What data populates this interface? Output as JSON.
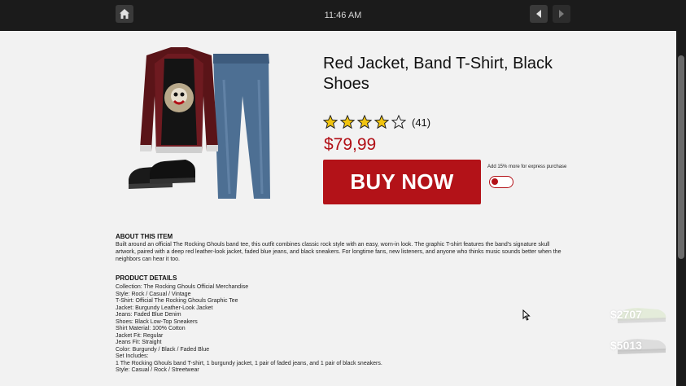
{
  "system_bar": {
    "time": "11:46 AM",
    "icons": [
      "home-icon",
      "back-arrow-icon",
      "forward-arrow-icon"
    ]
  },
  "product": {
    "title": "Red Jacket, Band T-Shirt, Black Shoes",
    "rating": 4,
    "rating_max": 5,
    "rating_count": "(41)",
    "price": "$79,99",
    "buy_label": "BUY NOW",
    "express_label": "Add 15% more for express purchase",
    "express_enabled": false,
    "accent_color": "#b31218"
  },
  "about": {
    "heading": "ABOUT THIS ITEM",
    "text": "Built around an official The Rocking Ghouls band tee, this outfit combines classic rock style with an easy, worn-in look. The graphic T-shirt features the band's signature skull artwork, paired with a deep red leather-look jacket, faded blue jeans, and black sneakers. For longtime fans, new listeners, and anyone who thinks music sounds better when the neighbors can hear it too."
  },
  "details": {
    "heading": "PRODUCT DETAILS",
    "items": [
      "Collection: The Rocking Ghouls Official Merchandise",
      "Style: Rock / Casual / Vintage",
      "T-Shirt: Official The Rocking Ghouls Graphic Tee",
      "Jacket: Burgundy Leather-Look Jacket",
      "Jeans: Faded Blue Denim",
      "Shoes: Black Low-Top Sneakers",
      "Shirt Material: 100% Cotton",
      "Jacket Fit: Regular",
      "Jeans Fit: Straight",
      "Color: Burgundy / Black / Faded Blue",
      "Set Includes:",
      "1 The Rocking Ghouls band T-shirt, 1 burgundy jacket, 1 pair of faded jeans, and 1 pair of black sneakers.",
      "Style: Casual / Rock / Streetwear"
    ]
  },
  "side_deals": [
    {
      "price": "$2707"
    },
    {
      "price": "$5013"
    }
  ]
}
